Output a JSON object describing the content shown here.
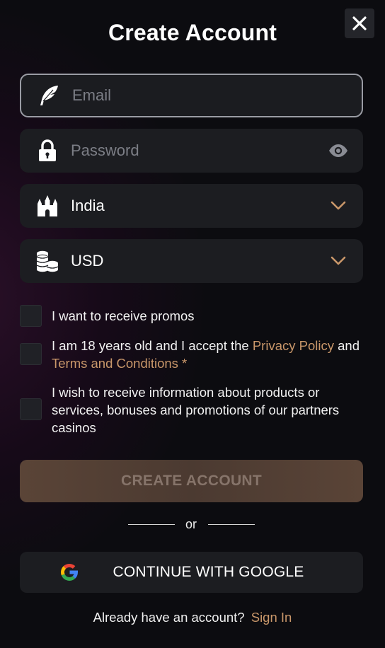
{
  "header": {
    "title": "Create Account"
  },
  "form": {
    "email": {
      "placeholder": "Email",
      "icon": "feather-icon"
    },
    "password": {
      "placeholder": "Password",
      "icon": "lock-icon",
      "toggle_icon": "eye-icon"
    },
    "country": {
      "value": "India",
      "icon": "castle-icon",
      "dropdown_icon": "chevron-down-icon"
    },
    "currency": {
      "value": "USD",
      "icon": "coins-icon",
      "dropdown_icon": "chevron-down-icon"
    }
  },
  "checkboxes": {
    "promos": {
      "label": "I want to receive promos",
      "checked": false
    },
    "age": {
      "text_before": "I am 18 years old and I accept the ",
      "privacy_link": "Privacy Policy",
      "text_middle": " and ",
      "terms_link": "Terms and Conditions *",
      "checked": false
    },
    "partners": {
      "label": "I wish to receive information about products or services, bonuses and promotions of our partners casinos",
      "checked": false
    }
  },
  "actions": {
    "create_label": "CREATE ACCOUNT",
    "or_label": "or",
    "google_label": "CONTINUE WITH GOOGLE"
  },
  "footer": {
    "prompt": "Already have an account?",
    "signin_label": "Sign In"
  },
  "colors": {
    "accent": "#c9976a",
    "field_bg": "#1c1d21",
    "create_button_bg": "#5a4437",
    "create_button_text": "#86746a"
  }
}
